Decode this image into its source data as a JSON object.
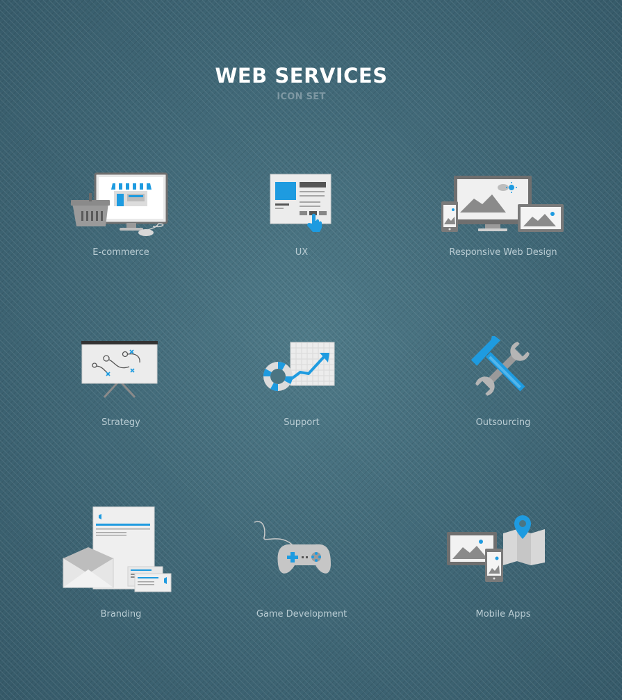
{
  "header": {
    "title": "WEB SERVICES",
    "subtitle": "ICON SET"
  },
  "accent_color": "#1e9be0",
  "items": [
    {
      "label": "E-commerce",
      "icon": "ecommerce-icon"
    },
    {
      "label": "UX",
      "icon": "ux-icon"
    },
    {
      "label": "Responsive Web Design",
      "icon": "responsive-design-icon"
    },
    {
      "label": "Strategy",
      "icon": "strategy-icon"
    },
    {
      "label": "Support",
      "icon": "support-icon"
    },
    {
      "label": "Outsourcing",
      "icon": "outsourcing-icon"
    },
    {
      "label": "Branding",
      "icon": "branding-icon"
    },
    {
      "label": "Game Development",
      "icon": "game-development-icon"
    },
    {
      "label": "Mobile Apps",
      "icon": "mobile-apps-icon"
    }
  ]
}
